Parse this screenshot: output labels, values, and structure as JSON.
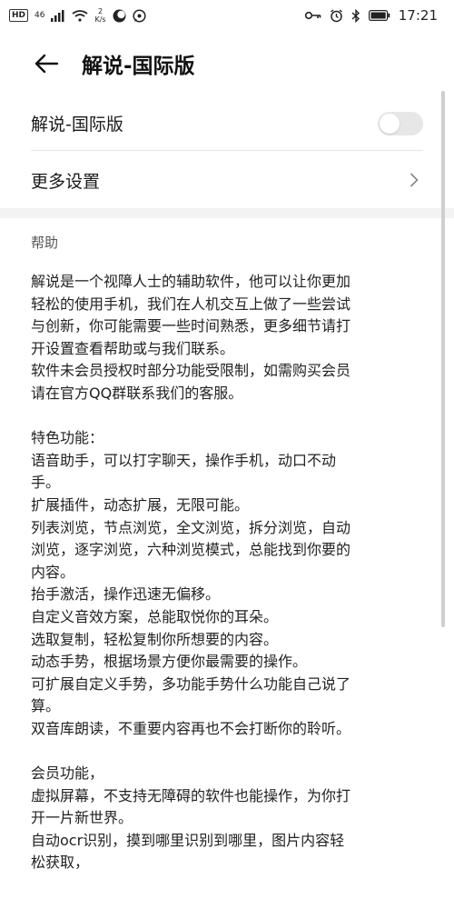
{
  "status_bar": {
    "hd": "HD",
    "network": "46",
    "speed_value": "2",
    "speed_unit": "K/s",
    "time": "17:21"
  },
  "header": {
    "title": "解说-国际版",
    "icons": {
      "back": "arrow-left"
    }
  },
  "settings": {
    "toggle_label": "解说-国际版",
    "toggle_state": "off",
    "more_label": "更多设置"
  },
  "help": {
    "title": "帮助",
    "lines": [
      "解说是一个视障人士的辅助软件，他可以让你更加",
      "轻松的使用手机，我们在人机交互上做了一些尝试",
      "与创新，你可能需要一些时间熟悉，更多细节请打",
      "开设置查看帮助或与我们联系。",
      " 软件未会员授权时部分功能受限制，如需购买会员",
      "请在官方QQ群联系我们的客服。",
      "",
      " 特色功能：",
      " 语音助手，可以打字聊天，操作手机，动口不动",
      "手。",
      " 扩展插件，动态扩展，无限可能。",
      " 列表浏览，节点浏览，全文浏览，拆分浏览，自动",
      "浏览，逐字浏览，六种浏览模式，总能找到你要的",
      "内容。",
      " 抬手激活，操作迅速无偏移。",
      " 自定义音效方案，总能取悦你的耳朵。",
      " 选取复制，轻松复制你所想要的内容。",
      " 动态手势，根据场景方便你最需要的操作。",
      " 可扩展自定义手势，多功能手势什么功能自己说了",
      "算。",
      " 双音库朗读，不重要内容再也不会打断你的聆听。",
      "",
      " 会员功能，",
      " 虚拟屏幕，不支持无障碍的软件也能操作，为你打",
      "开一片新世界。",
      " 自动ocr识别，摸到哪里识别到哪里，图片内容轻",
      "松获取，"
    ]
  },
  "colors": {
    "toggle_off": "#e7e7e7",
    "divider": "#f3f3f3",
    "text": "#222222"
  }
}
